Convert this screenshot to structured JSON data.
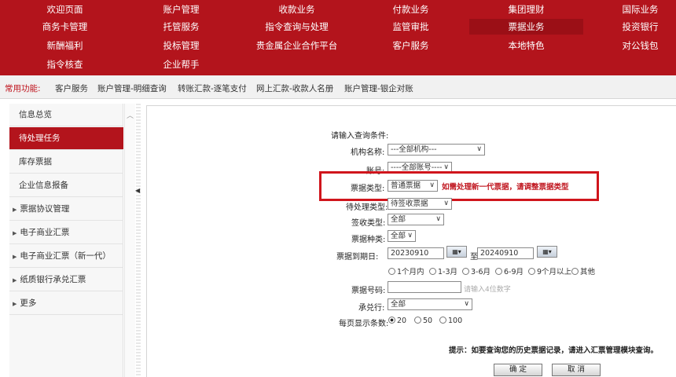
{
  "nav": {
    "items": [
      "欢迎页面",
      "账户管理",
      "收款业务",
      "付款业务",
      "集团理财",
      "国际业务",
      "商务卡管理",
      "托管服务",
      "指令查询与处理",
      "监管审批",
      "票据业务",
      "投资银行",
      "新酬福利",
      "投标管理",
      "贵金属企业合作平台",
      "客户服务",
      "本地特色",
      "对公钱包",
      "指令核查",
      "企业帮手"
    ]
  },
  "quick": {
    "label": "常用功能:",
    "links": [
      "客户服务",
      "账户管理-明细查询",
      "转账汇款-逐笔支付",
      "网上汇款-收款人名册",
      "账户管理-银企对账"
    ]
  },
  "sidebar": {
    "items": [
      "信息总览",
      "待处理任务",
      "库存票据",
      "企业信息报备",
      "票据协议管理",
      "电子商业汇票",
      "电子商业汇票（新一代）",
      "纸质银行承兑汇票",
      "更多"
    ]
  },
  "form": {
    "heading": "请输入查询条件:",
    "org_label": "机构名称:",
    "org_value": "---全部机构---",
    "acct_label": "账号:",
    "acct_value": "----全部账号----",
    "bill_type_label": "票据类型:",
    "bill_type_value": "普通票据",
    "bill_type_hint": "如需处理新一代票据，请调整票据类型",
    "pending_label": "待处理类型:",
    "pending_value": "待签收票据",
    "sign_label": "签收类型:",
    "sign_value": "全部",
    "kind_label": "票据种类:",
    "kind_value": "全部",
    "due_label": "票据到期日:",
    "date_from": "20230910",
    "date_to_word": "至",
    "date_to": "20240910",
    "range_options": [
      "1个月内",
      "1-3月",
      "3-6月",
      "6-9月",
      "9个月以上",
      "其他"
    ],
    "billno_label": "票据号码:",
    "billno_placeholder": "请输入4位数字",
    "acceptor_label": "承兑行:",
    "acceptor_value": "全部",
    "pagesize_label": "每页显示条数:",
    "pagesize_options": [
      "20",
      "50",
      "100"
    ],
    "pagesize_selected": "20",
    "tip": "提示：如要查询您的历史票据记录，请进入汇票管理模块查询。",
    "ok_label": "确 定",
    "cancel_label": "取 消"
  },
  "colors": {
    "brand_red": "#b3141c",
    "highlight_red": "#d0151c"
  }
}
